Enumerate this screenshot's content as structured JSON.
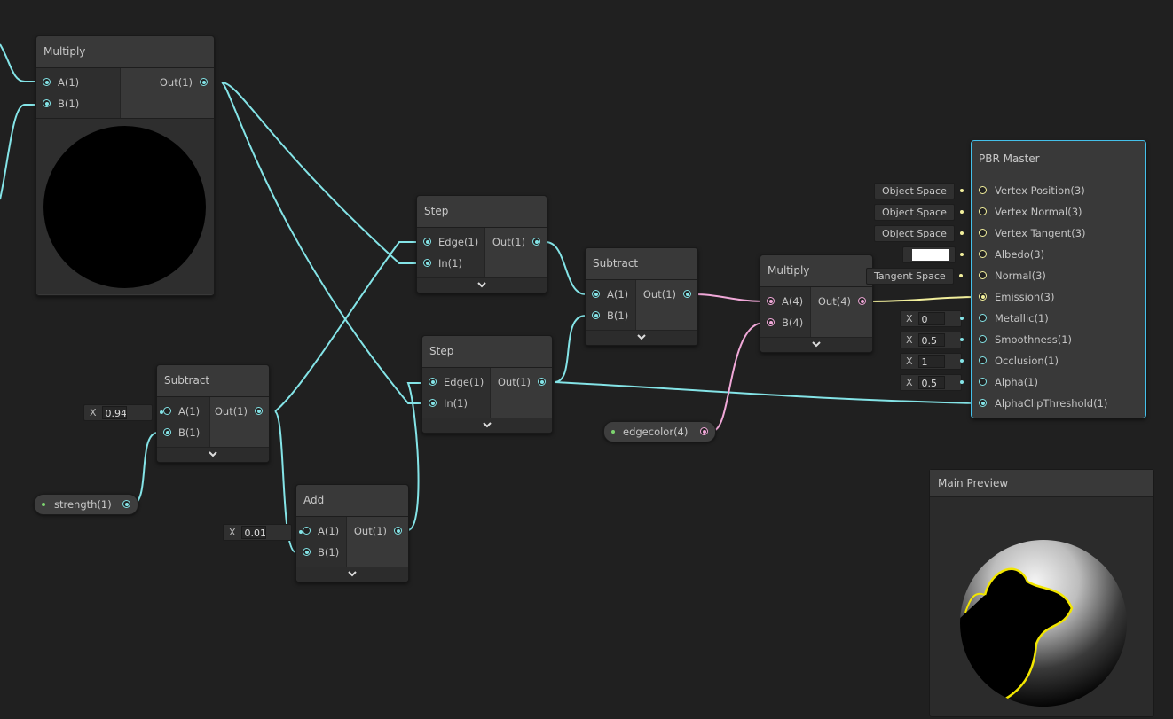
{
  "nodes": {
    "multiply1": {
      "title": "Multiply",
      "in_a": "A(1)",
      "in_b": "B(1)",
      "out": "Out(1)"
    },
    "subtract1": {
      "title": "Subtract",
      "in_a": "A(1)",
      "in_b": "B(1)",
      "out": "Out(1)",
      "a_label": "X",
      "a_value": "0.94"
    },
    "add": {
      "title": "Add",
      "in_a": "A(1)",
      "in_b": "B(1)",
      "out": "Out(1)",
      "a_label": "X",
      "a_value": "0.01"
    },
    "step1": {
      "title": "Step",
      "in_a": "Edge(1)",
      "in_b": "In(1)",
      "out": "Out(1)"
    },
    "step2": {
      "title": "Step",
      "in_a": "Edge(1)",
      "in_b": "In(1)",
      "out": "Out(1)"
    },
    "subtract2": {
      "title": "Subtract",
      "in_a": "A(1)",
      "in_b": "B(1)",
      "out": "Out(1)"
    },
    "multiply2": {
      "title": "Multiply",
      "in_a": "A(4)",
      "in_b": "B(4)",
      "out": "Out(4)"
    }
  },
  "properties": {
    "strength": "strength(1)",
    "edgecolor": "edgecolor(4)"
  },
  "master": {
    "title": "PBR Master",
    "ports": [
      "Vertex Position(3)",
      "Vertex Normal(3)",
      "Vertex Tangent(3)",
      "Albedo(3)",
      "Normal(3)",
      "Emission(3)",
      "Metallic(1)",
      "Smoothness(1)",
      "Occlusion(1)",
      "Alpha(1)",
      "AlphaClipThreshold(1)"
    ],
    "fields": {
      "vertex_position_space": "Object Space",
      "vertex_normal_space": "Object Space",
      "vertex_tangent_space": "Object Space",
      "normal_space": "Tangent Space",
      "x_label": "X",
      "metallic": "0",
      "smoothness": "0.5",
      "occlusion": "1",
      "alpha": "0.5"
    },
    "albedo_color": "#ffffff"
  },
  "preview": {
    "title": "Main Preview"
  },
  "colors": {
    "float_wire": "#84e4e7",
    "vec4_wire": "#f0a8d8",
    "vec3_wire": "#f2ef9c",
    "selected_outline": "#44c0ea",
    "canvas": "#202020"
  }
}
